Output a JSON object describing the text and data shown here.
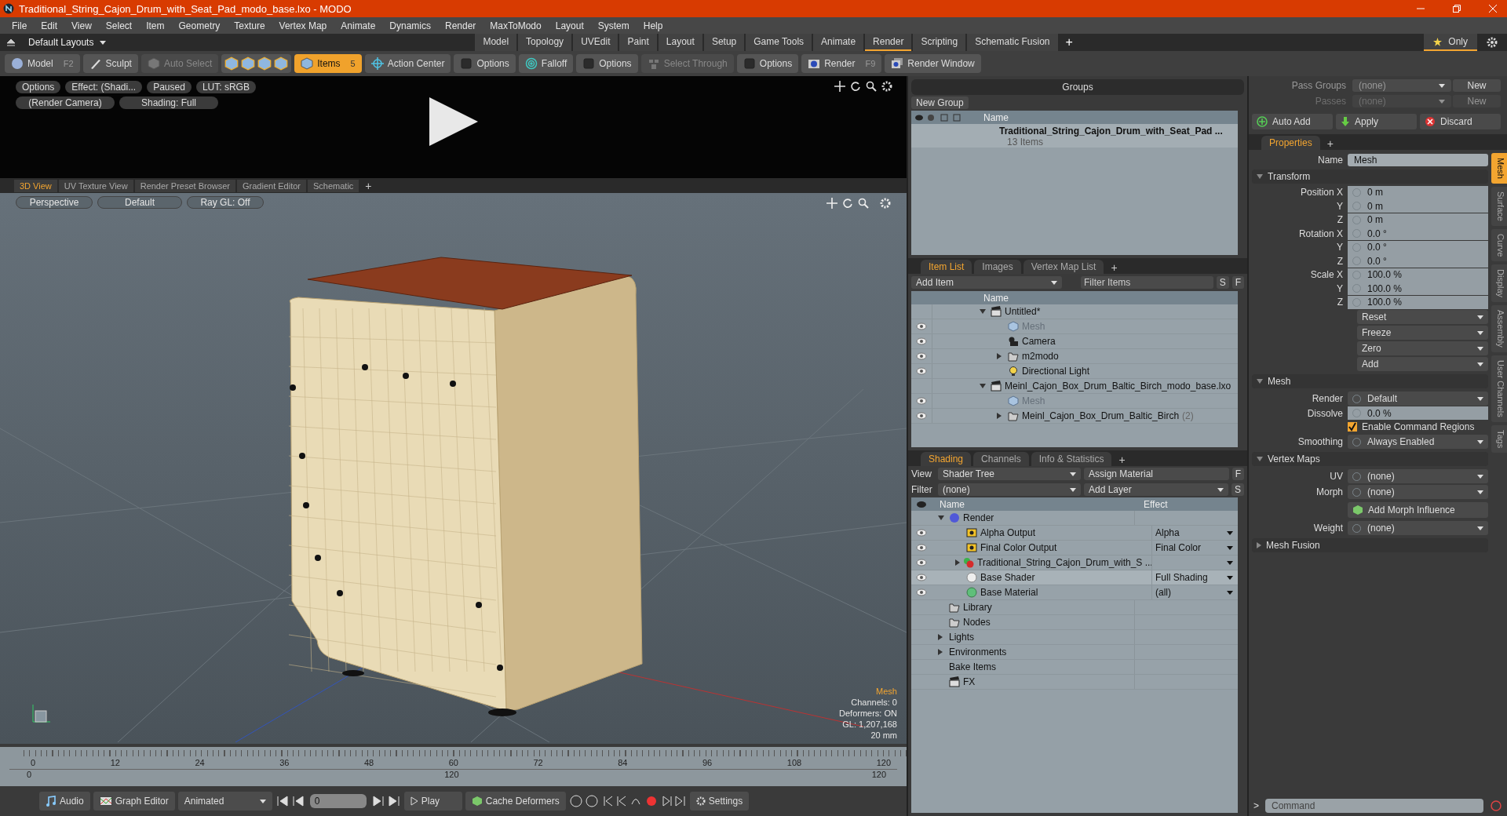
{
  "window": {
    "title": "Traditional_String_Cajon_Drum_with_Seat_Pad_modo_base.lxo - MODO"
  },
  "menu": [
    "File",
    "Edit",
    "View",
    "Select",
    "Item",
    "Geometry",
    "Texture",
    "Vertex Map",
    "Animate",
    "Dynamics",
    "Render",
    "MaxToModo",
    "Layout",
    "System",
    "Help"
  ],
  "layout_bar": {
    "layouts": "Default Layouts",
    "tabs": [
      {
        "label": "Model",
        "selected": false
      },
      {
        "label": "Topology",
        "selected": false
      },
      {
        "label": "UVEdit",
        "selected": false
      },
      {
        "label": "Paint",
        "selected": false
      },
      {
        "label": "Layout",
        "selected": false
      },
      {
        "label": "Setup",
        "selected": false
      },
      {
        "label": "Game Tools",
        "selected": false
      },
      {
        "label": "Animate",
        "selected": false
      },
      {
        "label": "Render",
        "selected": true
      },
      {
        "label": "Scripting",
        "selected": false
      },
      {
        "label": "Schematic Fusion",
        "selected": false
      }
    ],
    "add": "+",
    "only": "Only"
  },
  "toolbar": [
    {
      "kind": "sphere",
      "label": "Model",
      "shortcut": "F2",
      "selected": false,
      "disabled": false
    },
    {
      "kind": "brush",
      "label": "Sculpt",
      "selected": false,
      "disabled": false
    },
    {
      "kind": "cube",
      "label": "Auto Select",
      "selected": false,
      "disabled": true
    },
    {
      "kind": "cubes"
    },
    {
      "kind": "cube",
      "label": "Items",
      "shortcut": "5",
      "selected": true,
      "disabled": false
    },
    {
      "kind": "crosshair",
      "label": "Action Center",
      "selected": false,
      "disabled": false
    },
    {
      "kind": "checkbox",
      "label": "Options",
      "selected": false,
      "disabled": false
    },
    {
      "kind": "target",
      "label": "Falloff",
      "selected": false,
      "disabled": false
    },
    {
      "kind": "checkbox",
      "label": "Options",
      "selected": false,
      "disabled": false
    },
    {
      "kind": "through",
      "label": "Select Through",
      "selected": false,
      "disabled": true
    },
    {
      "kind": "checkbox",
      "label": "Options",
      "selected": false,
      "disabled": false
    },
    {
      "kind": "render",
      "label": "Render",
      "shortcut": "F9",
      "selected": false,
      "disabled": false
    },
    {
      "kind": "window",
      "label": "Render Window",
      "selected": false,
      "disabled": false
    }
  ],
  "preview": {
    "row_1": [
      "Options",
      "Effect: (Shadi...",
      "Paused",
      "LUT: sRGB"
    ],
    "row_2": [
      "(Render Camera)",
      "Shading: Full"
    ]
  },
  "viewport": {
    "tabs": [
      {
        "label": "3D View",
        "selected": true
      },
      {
        "label": "UV Texture View",
        "selected": false
      },
      {
        "label": "Render Preset Browser",
        "selected": false
      },
      {
        "label": "Gradient Editor",
        "selected": false
      },
      {
        "label": "Schematic",
        "selected": false
      }
    ],
    "add": "+",
    "buttons": [
      "Perspective",
      "Default",
      "Ray GL: Off"
    ],
    "info_title": "Mesh",
    "info_lines": [
      "Channels: 0",
      "Deformers: ON",
      "GL: 1,207,168",
      "20 mm"
    ]
  },
  "timeline": {
    "ticks": [
      "0",
      "12",
      "24",
      "36",
      "48",
      "60",
      "72",
      "84",
      "96",
      "108",
      "120"
    ],
    "range": [
      "0",
      "120",
      "120"
    ]
  },
  "bottom_bar": {
    "audio": "Audio",
    "graph_editor": "Graph Editor",
    "mode": "Animated",
    "frame": "0",
    "play": "Play",
    "cache": "Cache Deformers",
    "settings": "Settings"
  },
  "groups": {
    "title": "Groups",
    "new_group": "New Group",
    "column": "Name",
    "rows": [
      {
        "name": "Traditional_String_Cajon_Drum_with_Seat_Pad ...",
        "count": "13 Items"
      }
    ]
  },
  "item_list": {
    "tabs": [
      {
        "label": "Item List",
        "selected": true
      },
      {
        "label": "Images",
        "selected": false
      },
      {
        "label": "Vertex Map List",
        "selected": false
      }
    ],
    "add": "+",
    "add_item": "Add Item",
    "filter": {
      "placeholder": "Filter Items"
    },
    "s": "S",
    "f": "F",
    "column": "Name",
    "tree": [
      {
        "name": "Untitled*",
        "kind": "scene",
        "expanded": true,
        "visible": false,
        "dimmed": false,
        "children": [
          {
            "name": "Mesh",
            "kind": "mesh",
            "visible": true,
            "dimmed": true
          },
          {
            "name": "Camera",
            "kind": "camera",
            "visible": true,
            "dimmed": false
          },
          {
            "name": "m2modo",
            "kind": "folder",
            "expanded": false,
            "visible": true,
            "dimmed": false
          },
          {
            "name": "Directional Light",
            "kind": "light",
            "visible": true,
            "dimmed": false
          }
        ]
      },
      {
        "name": "Meinl_Cajon_Box_Drum_Baltic_Birch_modo_base.lxo",
        "kind": "scene",
        "expanded": true,
        "visible": false,
        "dimmed": false,
        "children": [
          {
            "name": "Mesh",
            "kind": "mesh",
            "visible": true,
            "dimmed": true
          },
          {
            "name": "Meinl_Cajon_Box_Drum_Baltic_Birch",
            "kind": "folder",
            "expanded": false,
            "visible": true,
            "dimmed": false,
            "count": "(2)"
          }
        ]
      }
    ]
  },
  "shading": {
    "tabs": [
      {
        "label": "Shading",
        "selected": true
      },
      {
        "label": "Channels",
        "selected": false
      },
      {
        "label": "Info & Statistics",
        "selected": false
      }
    ],
    "add": "+",
    "view_label": "View",
    "view": "Shader Tree",
    "assign": "Assign Material",
    "f": "F",
    "filter_label": "Filter",
    "filter": "(none)",
    "add_layer": "Add Layer",
    "s": "S",
    "columns": [
      "Name",
      "Effect"
    ],
    "tree": [
      {
        "name": "Render",
        "kind": "render",
        "expanded": true,
        "visible": false,
        "selected": false,
        "children": [
          {
            "name": "Alpha Output",
            "kind": "output",
            "visible": true,
            "selected": false,
            "effect": "Alpha"
          },
          {
            "name": "Final Color Output",
            "kind": "output",
            "visible": true,
            "selected": false,
            "effect": "Final Color"
          },
          {
            "name": "Traditional_String_Cajon_Drum_with_S ...",
            "kind": "material-group",
            "expanded": false,
            "visible": true,
            "selected": false
          },
          {
            "name": "Base Shader",
            "kind": "shader",
            "visible": true,
            "selected": true,
            "effect": "Full Shading"
          },
          {
            "name": "Base Material",
            "kind": "material",
            "visible": true,
            "selected": false,
            "effect": "(all)"
          }
        ]
      },
      {
        "name": "Library",
        "kind": "folder",
        "visible": false,
        "selected": false
      },
      {
        "name": "Nodes",
        "kind": "folder",
        "visible": false,
        "selected": false
      },
      {
        "name": "Lights",
        "kind": "none",
        "expanded": false,
        "visible": false,
        "selected": false
      },
      {
        "name": "Environments",
        "kind": "none",
        "expanded": false,
        "visible": false,
        "selected": false
      },
      {
        "name": "Bake Items",
        "kind": "none",
        "visible": false,
        "selected": false
      },
      {
        "name": "FX",
        "kind": "scene",
        "visible": false,
        "selected": false
      }
    ]
  },
  "passes": {
    "rows": [
      {
        "label": "Pass Groups",
        "value": "(none)",
        "button": "New",
        "disabled": false
      },
      {
        "label": "Passes",
        "value": "(none)",
        "button": "New",
        "disabled": true
      }
    ],
    "auto_add": "Auto Add",
    "apply": "Apply",
    "discard": "Discard"
  },
  "properties": {
    "tabs": [
      {
        "label": "Properties",
        "selected": true
      }
    ],
    "add": "+",
    "name_label": "Name",
    "name": "Mesh",
    "sections": [
      {
        "title": "Transform",
        "expanded": true,
        "rows": [
          {
            "kind": "value",
            "label": "Position X",
            "value": "0 m"
          },
          {
            "kind": "value",
            "label": "Y",
            "value": "0 m"
          },
          {
            "kind": "value",
            "label": "Z",
            "value": "0 m"
          },
          {
            "kind": "value",
            "label": "Rotation X",
            "value": "0.0 °"
          },
          {
            "kind": "value",
            "label": "Y",
            "value": "0.0 °"
          },
          {
            "kind": "value",
            "label": "Z",
            "value": "0.0 °"
          },
          {
            "kind": "value",
            "label": "Scale X",
            "value": "100.0 %"
          },
          {
            "kind": "value",
            "label": "Y",
            "value": "100.0 %"
          },
          {
            "kind": "value",
            "label": "Z",
            "value": "100.0 %"
          },
          {
            "kind": "menu",
            "value": "Reset"
          },
          {
            "kind": "menu",
            "value": "Freeze"
          },
          {
            "kind": "menu",
            "value": "Zero"
          },
          {
            "kind": "menu",
            "value": "Add"
          }
        ]
      },
      {
        "title": "Mesh",
        "expanded": true,
        "rows": [
          {
            "kind": "dropdown",
            "label": "Render",
            "value": "Default"
          },
          {
            "kind": "value",
            "label": "Dissolve",
            "value": "0.0 %"
          },
          {
            "kind": "check",
            "value": "Enable Command Regions",
            "checked": true
          },
          {
            "kind": "dropdown",
            "label": "Smoothing",
            "value": "Always Enabled"
          }
        ]
      },
      {
        "title": "Vertex Maps",
        "expanded": true,
        "rows": [
          {
            "kind": "dropdown",
            "label": "UV",
            "value": "(none)"
          },
          {
            "kind": "dropdown",
            "label": "Morph",
            "value": "(none)"
          },
          {
            "kind": "button",
            "value": "Add Morph Influence"
          },
          {
            "kind": "dropdown",
            "label": "Weight",
            "value": "(none)"
          }
        ]
      },
      {
        "title": "Mesh Fusion",
        "expanded": false
      }
    ],
    "side_tabs": [
      {
        "label": "Mesh",
        "selected": true
      },
      {
        "label": "Surface",
        "selected": false
      },
      {
        "label": "Curve",
        "selected": false
      },
      {
        "label": "Display",
        "selected": false
      },
      {
        "label": "Assembly",
        "selected": false
      },
      {
        "label": "User Channels",
        "selected": false
      },
      {
        "label": "Tags",
        "selected": false
      }
    ]
  },
  "command": {
    "prompt": ">",
    "placeholder": "Command"
  }
}
